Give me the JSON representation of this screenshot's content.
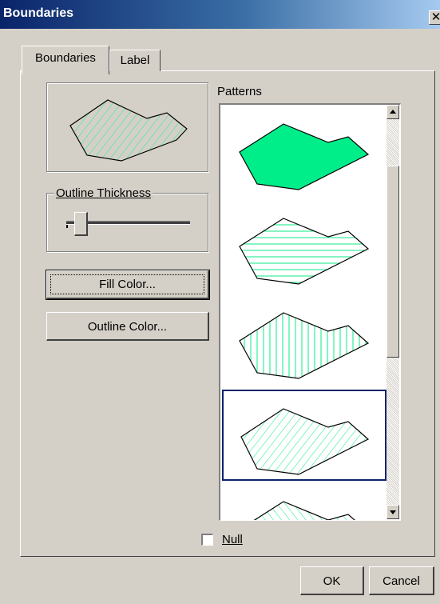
{
  "window": {
    "title": "Boundaries",
    "close_glyph": "✕"
  },
  "tabs": [
    {
      "label": "Boundaries",
      "active": true
    },
    {
      "label": "Label",
      "active": false
    }
  ],
  "outline_thickness": {
    "label": "Outline Thickness",
    "value_fraction": 0.07
  },
  "buttons": {
    "fill_color": "Fill Color...",
    "outline_color": "Outline Color...",
    "ok": "OK",
    "cancel": "Cancel"
  },
  "patterns": {
    "label": "Patterns",
    "items": [
      {
        "style": "solid",
        "selected": false
      },
      {
        "style": "horizontal-hatch",
        "selected": false
      },
      {
        "style": "vertical-hatch",
        "selected": false
      },
      {
        "style": "diagonal-hatch",
        "selected": true
      },
      {
        "style": "diagonal-hatch-alt",
        "selected": false
      }
    ]
  },
  "null_option": {
    "label": "Null",
    "checked": false
  },
  "colors": {
    "fill": "#00ee8a",
    "hatch": "#33ee99",
    "selection": "#0a246a",
    "title_bar": "#0a246a"
  },
  "icons": {
    "close": "close-icon",
    "scroll_up": "arrow-up-icon",
    "scroll_down": "arrow-down-icon"
  }
}
